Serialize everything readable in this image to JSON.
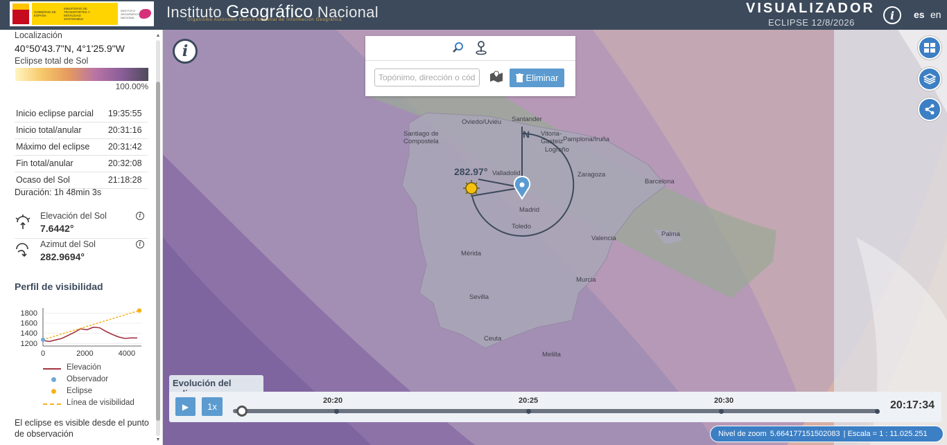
{
  "header": {
    "gov_line1": "GOBIERNO DE ESPAÑA",
    "gov_line2": "MINISTERIO DE TRANSPORTES Y MOVILIDAD SOSTENIBLE",
    "gov_line3": "INSTITUTO GEOGRÁFICO NACIONAL",
    "ign_word1": "Instituto",
    "ign_word2": "Geográfico",
    "ign_word3": "Nacional",
    "ign_sub": "Organismo Autónomo Centro Nacional de Información Geográfica",
    "app_title": "VISUALIZADOR",
    "app_subtitle": "ECLIPSE 12/8/2026",
    "lang_es": "es",
    "lang_en": "en"
  },
  "sidebar": {
    "location_label": "Localización",
    "location_value": "40°50'43.7\"N, 4°1'25.9\"W",
    "eclipse_label": "Eclipse total de Sol",
    "percentage": "100.00%",
    "times": [
      {
        "label": "Inicio eclipse parcial",
        "value": "19:35:55"
      },
      {
        "label": "Inicio total/anular",
        "value": "20:31:16"
      },
      {
        "label": "Máximo del eclipse",
        "value": "20:31:42"
      },
      {
        "label": "Fin total/anular",
        "value": "20:32:08"
      },
      {
        "label": "Ocaso del Sol",
        "value": "21:18:28"
      }
    ],
    "duration": "Duración: 1h 48min 3s",
    "elevation_label": "Elevación del Sol",
    "elevation_value": "7.6442°",
    "azimuth_label": "Azimut del Sol",
    "azimuth_value": "282.9694°",
    "profile_title": "Perfil de visibilidad",
    "legend": {
      "elevation": "Elevación",
      "observer": "Observador",
      "eclipse": "Eclipse",
      "visibility": "Línea de visibilidad"
    },
    "visible_note": "El eclipse es visible desde el punto de observación"
  },
  "chart_data": {
    "type": "line",
    "y_ticks": [
      "1800",
      "1600",
      "1400",
      "1200"
    ],
    "x_ticks": [
      "0",
      "2000",
      "4000"
    ],
    "xlim": [
      0,
      4700
    ],
    "ylim": [
      1150,
      1900
    ],
    "series": [
      {
        "name": "Elevación",
        "x": [
          0,
          300,
          600,
          900,
          1200,
          1500,
          1800,
          2100,
          2400,
          2700,
          3000,
          3300,
          3600,
          3900,
          4200,
          4500
        ],
        "y": [
          1260,
          1240,
          1270,
          1300,
          1360,
          1420,
          1490,
          1470,
          1520,
          1510,
          1440,
          1380,
          1330,
          1300,
          1310,
          1310
        ]
      },
      {
        "name": "Observador",
        "x": [
          0
        ],
        "y": [
          1275
        ]
      },
      {
        "name": "Eclipse",
        "x": [
          4600
        ],
        "y": [
          1850
        ]
      },
      {
        "name": "Línea de visibilidad",
        "x": [
          0,
          4600
        ],
        "y": [
          1275,
          1850
        ]
      }
    ],
    "colors": {
      "elevation": "#a33340",
      "observer": "#6fa8d6",
      "eclipse": "#f5b21f",
      "visibility": "#f5b21f"
    }
  },
  "map": {
    "search_placeholder": "Topónimo, dirección o código postal",
    "delete_label": "Eliminar",
    "azimuth_label": "282.97°",
    "north_label": "N",
    "cities": [
      "Oviedo/Uviéu",
      "Santander",
      "Santiago de Compostela",
      "Vitoria-Gasteiz",
      "Pamplona/Iruña",
      "Logroño",
      "Valladolid",
      "Zaragoza",
      "Barcelona",
      "Madrid",
      "Toledo",
      "Palma",
      "Valencia",
      "Mérida",
      "Murcia",
      "Sevilla",
      "Ceuta",
      "Melilla"
    ]
  },
  "timeline": {
    "title": "Evolución del eclipse",
    "play_label": "▶",
    "speed_label": "1x",
    "ticks": [
      "20:20",
      "20:25",
      "20:30"
    ],
    "current_time": "20:17:34",
    "zoom_label": "Nivel de zoom",
    "zoom_value": "5.664177151502083",
    "scale_label": "| Escala = 1 : 11.025.251"
  },
  "icons": {
    "info": "info-icon",
    "search": "search-icon",
    "marker": "marker-icon",
    "map": "map-icon",
    "trash": "trash-icon",
    "grid": "grid-icon",
    "layers": "layers-icon",
    "share": "share-icon",
    "sun": "sun-icon"
  }
}
